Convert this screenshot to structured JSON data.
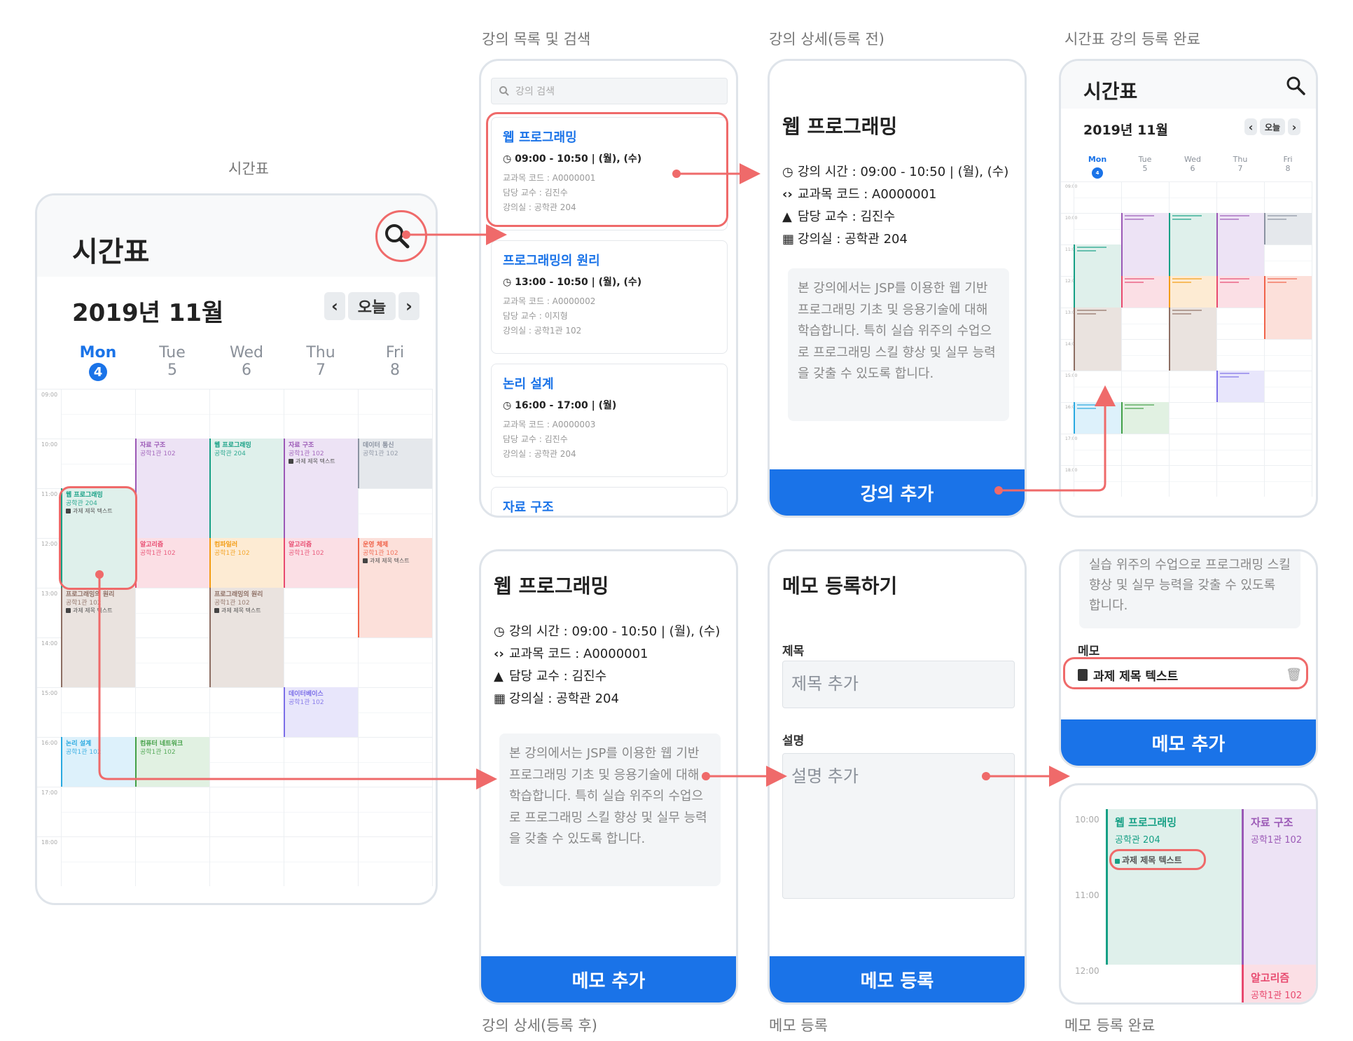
{
  "captions": {
    "timetable": "시간표",
    "list": "강의 목록 및 검색",
    "detail_before": "강의 상세(등록 전)",
    "registered": "시간표 강의 등록 완료",
    "detail_after": "강의 상세(등록 후)",
    "memo_register": "메모 등록",
    "memo_done": "메모 등록 완료"
  },
  "timetable": {
    "title": "시간표",
    "month": "2019년 11월",
    "today": "오늘",
    "prev": "‹",
    "next": "›",
    "days": [
      {
        "name": "Mon",
        "num": "4",
        "current": true
      },
      {
        "name": "Tue",
        "num": "5",
        "current": false
      },
      {
        "name": "Wed",
        "num": "6",
        "current": false
      },
      {
        "name": "Thu",
        "num": "7",
        "current": false
      },
      {
        "name": "Fri",
        "num": "8",
        "current": false
      }
    ],
    "times": [
      "09:00",
      "10:00",
      "11:00",
      "12:00",
      "13:00",
      "14:00",
      "15:00",
      "16:00",
      "17:00",
      "18:00"
    ],
    "events": [
      {
        "day": 1,
        "start": 10,
        "end": 12,
        "name": "자료 구조",
        "room": "공학1관 102",
        "memo": "",
        "color": "#9b59b6",
        "bg": "#ede3f5"
      },
      {
        "day": 2,
        "start": 10,
        "end": 12,
        "name": "웹 프로그래밍",
        "room": "공학관 204",
        "memo": "",
        "color": "#16a085",
        "bg": "#dff0eb"
      },
      {
        "day": 3,
        "start": 10,
        "end": 12,
        "name": "자료 구조",
        "room": "공학1관 102",
        "memo": "과제 제목 텍스트",
        "color": "#9b59b6",
        "bg": "#ede3f5"
      },
      {
        "day": 4,
        "start": 10,
        "end": 11,
        "name": "데이터 통신",
        "room": "공학1관 102",
        "memo": "",
        "color": "#8b93a1",
        "bg": "#e5e8ec"
      },
      {
        "day": 0,
        "start": 11,
        "end": 13,
        "name": "웹 프로그래밍",
        "room": "공학관 204",
        "memo": "과제 제목 텍스트",
        "color": "#16a085",
        "bg": "#dff0eb"
      },
      {
        "day": 1,
        "start": 12,
        "end": 13,
        "name": "알고리즘",
        "room": "공학1관 102",
        "memo": "",
        "color": "#e84a6f",
        "bg": "#fbdfe5"
      },
      {
        "day": 2,
        "start": 12,
        "end": 13,
        "name": "컴파일러",
        "room": "공학1관 102",
        "memo": "",
        "color": "#f39c12",
        "bg": "#fdebd3"
      },
      {
        "day": 3,
        "start": 12,
        "end": 13,
        "name": "알고리즘",
        "room": "공학1관 102",
        "memo": "",
        "color": "#e84a6f",
        "bg": "#fbdfe5"
      },
      {
        "day": 4,
        "start": 12,
        "end": 14,
        "name": "운영 체제",
        "room": "공학1관 102",
        "memo": "과제 제목 텍스트",
        "color": "#f0634a",
        "bg": "#fce0da"
      },
      {
        "day": 0,
        "start": 13,
        "end": 15,
        "name": "프로그래밍의 원리",
        "room": "공학1관 102",
        "memo": "과제 제목 텍스트",
        "color": "#8d6e63",
        "bg": "#eae3df"
      },
      {
        "day": 2,
        "start": 13,
        "end": 15,
        "name": "프로그래밍의 원리",
        "room": "공학1관 102",
        "memo": "과제 제목 텍스트",
        "color": "#8d6e63",
        "bg": "#eae3df"
      },
      {
        "day": 3,
        "start": 15,
        "end": 16,
        "name": "데이터베이스",
        "room": "공학1관 102",
        "memo": "",
        "color": "#7b6ee8",
        "bg": "#e8e6fb"
      },
      {
        "day": 0,
        "start": 16,
        "end": 17,
        "name": "논리 설계",
        "room": "공학1관 102",
        "memo": "",
        "color": "#29a9e0",
        "bg": "#ddf1fb"
      },
      {
        "day": 1,
        "start": 16,
        "end": 17,
        "name": "컴퓨터 네트워크",
        "room": "공학1관 102",
        "memo": "",
        "color": "#43a047",
        "bg": "#e1f1e2"
      }
    ]
  },
  "list": {
    "search_placeholder": "강의 검색",
    "items": [
      {
        "name": "웹 프로그래밍",
        "time": "09:00 - 10:50 | (월), (수)",
        "code": "교과목 코드 : A0000001",
        "prof": "담당 교수 : 김진수",
        "room": "강의실 : 공학관 204"
      },
      {
        "name": "프로그래밍의 원리",
        "time": "13:00 - 10:50 | (월), (수)",
        "code": "교과목 코드 : A0000002",
        "prof": "담당 교수 : 이지형",
        "room": "강의실 : 공학1관 102"
      },
      {
        "name": "논리 설계",
        "time": "16:00 - 17:00 | (월)",
        "code": "교과목 코드 : A0000003",
        "prof": "담당 교수 : 김진수",
        "room": "강의실 : 공학관 204"
      },
      {
        "name": "자료 구조",
        "time": "",
        "code": "",
        "prof": "",
        "room": ""
      }
    ]
  },
  "detail": {
    "title": "웹 프로그래밍",
    "time": "강의 시간 : 09:00 - 10:50 | (월), (수)",
    "code": "교과목 코드 : A0000001",
    "prof": "담당 교수 : 김진수",
    "room": "강의실 : 공학관 204",
    "desc": "본 강의에서는 JSP를 이용한 웹 기반 프로그래밍 기초 및 응용기술에 대해 학습합니다. 특히 실습 위주의 수업으로 프로그래밍 스킬 향상 및 실무 능력을 갖출 수 있도록 합니다.",
    "add_button": "강의 추가",
    "memo_add_button": "메모 추가"
  },
  "memo_form": {
    "title": "메모 등록하기",
    "title_label": "제목",
    "title_placeholder": "제목 추가",
    "desc_label": "설명",
    "desc_placeholder": "설명 추가",
    "submit": "메모 등록"
  },
  "memo_done": {
    "desc_tail": "실습 위주의 수업으로 프로그래밍 스킬 향상 및 실무 능력을 갖출 수 있도록 합니다.",
    "memo_label": "메모",
    "memo_item": "과제 제목 텍스트",
    "add_button": "메모 추가"
  },
  "zoom": {
    "times": [
      "10:00",
      "11:00",
      "12:00"
    ],
    "ev1_name": "웹 프로그래밍",
    "ev1_room": "공학관 204",
    "ev1_memo": "과제 제목 텍스트",
    "ev2_name": "자료 구조",
    "ev2_room": "공학1관 102",
    "ev3_name": "알고리즘",
    "ev3_room": "공학1관 102"
  },
  "colors": {
    "accent": "#1a73e8",
    "highlight": "#ef6a6a"
  }
}
